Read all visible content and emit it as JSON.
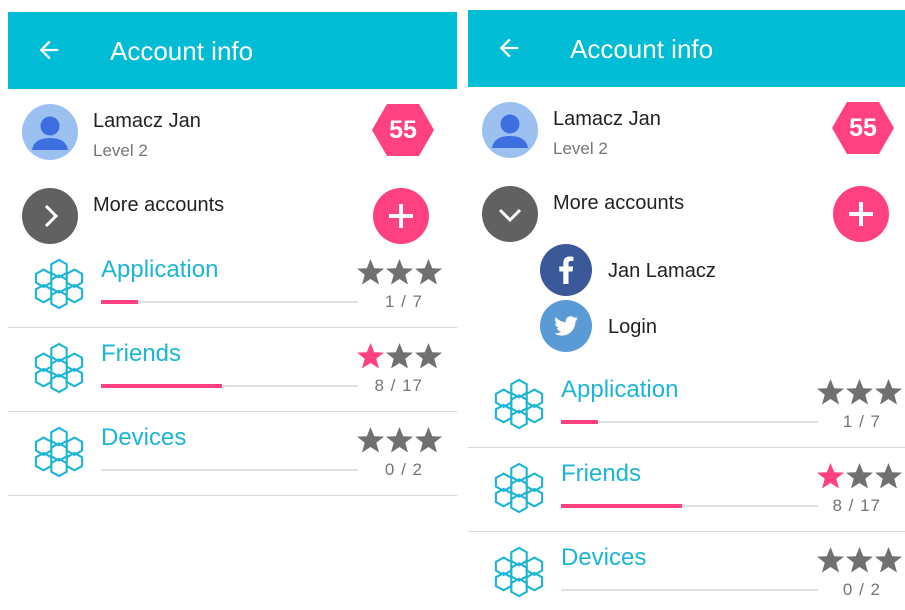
{
  "screens": [
    {
      "appbar": {
        "title": "Account info"
      },
      "user": {
        "name": "Lamacz Jan",
        "level": "Level 2",
        "points": "55"
      },
      "more_accounts": {
        "label": "More accounts",
        "expanded": false
      },
      "linked_accounts": [],
      "categories": [
        {
          "title": "Application",
          "progress": "1 / 7",
          "fraction": 0.143,
          "stars": 0
        },
        {
          "title": "Friends",
          "progress": "8 / 17",
          "fraction": 0.47,
          "stars": 1
        },
        {
          "title": "Devices",
          "progress": "0 / 2",
          "fraction": 0,
          "stars": 0
        }
      ]
    },
    {
      "appbar": {
        "title": "Account info"
      },
      "user": {
        "name": "Lamacz Jan",
        "level": "Level 2",
        "points": "55"
      },
      "more_accounts": {
        "label": "More accounts",
        "expanded": true
      },
      "linked_accounts": [
        {
          "service": "facebook",
          "icon": "facebook-icon",
          "label": "Jan  Lamacz"
        },
        {
          "service": "twitter",
          "icon": "twitter-icon",
          "label": "Login"
        }
      ],
      "categories": [
        {
          "title": "Application",
          "progress": "1 / 7",
          "fraction": 0.143,
          "stars": 0
        },
        {
          "title": "Friends",
          "progress": "8 / 17",
          "fraction": 0.47,
          "stars": 1
        },
        {
          "title": "Devices",
          "progress": "0 / 2",
          "fraction": 0,
          "stars": 0
        }
      ]
    }
  ],
  "colors": {
    "appbar": "#00bcd4",
    "accent": "#ff4081",
    "category_text": "#1cb5d6",
    "star_empty": "#707070",
    "star_filled": "#ff4081",
    "facebook": "#3b5998",
    "twitter": "#5b9bd5"
  }
}
